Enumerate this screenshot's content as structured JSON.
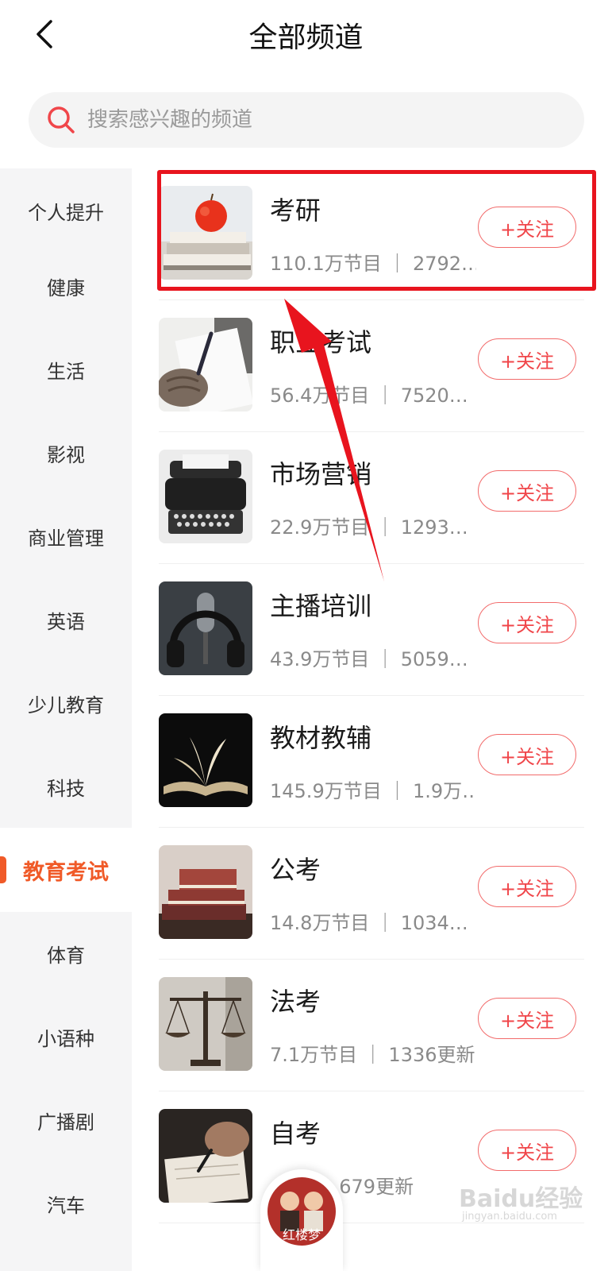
{
  "header": {
    "title": "全部频道"
  },
  "search": {
    "placeholder": "搜索感兴趣的频道"
  },
  "sidebar": {
    "items": [
      {
        "label": "个人提升"
      },
      {
        "label": "健康"
      },
      {
        "label": "生活"
      },
      {
        "label": "影视"
      },
      {
        "label": "商业管理"
      },
      {
        "label": "英语"
      },
      {
        "label": "少儿教育"
      },
      {
        "label": "科技"
      },
      {
        "label": "教育考试",
        "active": true
      },
      {
        "label": "体育"
      },
      {
        "label": "小语种"
      },
      {
        "label": "广播剧"
      },
      {
        "label": "汽车"
      }
    ]
  },
  "channels": [
    {
      "name": "考研",
      "meta": "110.1万节目 ｜ 2792…",
      "follow": "+关注",
      "image": "apple-on-books"
    },
    {
      "name": "职业考试",
      "meta": "56.4万节目 ｜ 7520…",
      "follow": "+关注",
      "image": "hand-writing"
    },
    {
      "name": "市场营销",
      "meta": "22.9万节目 ｜ 1293…",
      "follow": "+关注",
      "image": "typewriter"
    },
    {
      "name": "主播培训",
      "meta": "43.9万节目 ｜ 5059…",
      "follow": "+关注",
      "image": "headphones-microphone"
    },
    {
      "name": "教材教辅",
      "meta": "145.9万节目 ｜ 1.9万…",
      "follow": "+关注",
      "image": "open-book"
    },
    {
      "name": "公考",
      "meta": "14.8万节目 ｜ 1034…",
      "follow": "+关注",
      "image": "stacked-books"
    },
    {
      "name": "法考",
      "meta": "7.1万节目 ｜ 1336更新",
      "follow": "+关注",
      "image": "scales-of-justice"
    },
    {
      "name": "自考",
      "meta": "…目 ｜ 679更新",
      "follow": "+关注",
      "image": "hand-writing-notebook"
    }
  ],
  "mini_player": {
    "cover_text": "红楼梦"
  },
  "watermark": {
    "text": "Baidu经验",
    "sub": "jingyan.baidu.com"
  },
  "colors": {
    "accent": "#f05a28",
    "follow_red": "#f0464a",
    "annotation_red": "#e8141e"
  }
}
